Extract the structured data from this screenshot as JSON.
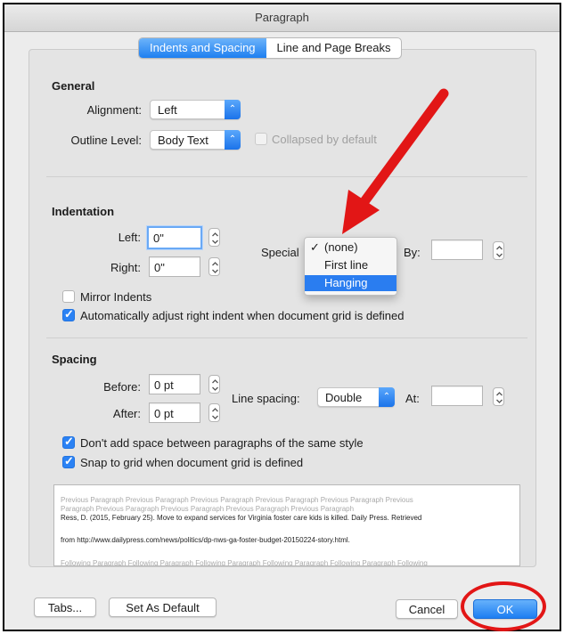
{
  "window": {
    "title": "Paragraph"
  },
  "tabs": [
    {
      "label": "Indents and Spacing",
      "active": true
    },
    {
      "label": "Line and Page Breaks",
      "active": false
    }
  ],
  "general": {
    "heading": "General",
    "alignment_label": "Alignment:",
    "alignment_value": "Left",
    "outline_label": "Outline Level:",
    "outline_value": "Body Text",
    "collapsed_label": "Collapsed by default"
  },
  "indentation": {
    "heading": "Indentation",
    "left_label": "Left:",
    "left_value": "0\"",
    "right_label": "Right:",
    "right_value": "0\"",
    "special_label": "Special",
    "by_label": "By:",
    "by_value": "",
    "mirror_label": "Mirror Indents",
    "auto_adjust_label": "Automatically adjust right indent when document grid is defined"
  },
  "special_menu": {
    "items": [
      "(none)",
      "First line",
      "Hanging"
    ],
    "checked_mark": "✓",
    "checked_item": "(none)",
    "highlighted_item": "Hanging"
  },
  "spacing": {
    "heading": "Spacing",
    "before_label": "Before:",
    "before_value": "0 pt",
    "after_label": "After:",
    "after_value": "0 pt",
    "line_spacing_label": "Line spacing:",
    "line_spacing_value": "Double",
    "at_label": "At:",
    "at_value": "",
    "dont_add_label": "Don't add space between paragraphs of the same style",
    "snap_label": "Snap to grid when document grid is defined"
  },
  "preview": {
    "line1": "Previous Paragraph Previous Paragraph Previous Paragraph Previous Paragraph Previous Paragraph Previous",
    "line2": "Paragraph Previous Paragraph Previous Paragraph Previous Paragraph Previous Paragraph",
    "line3": "Ress, D. (2015, February 25). Move to expand services for Virginia foster care kids is killed. Daily Press. Retrieved",
    "line4": "from http://www.dailypress.com/news/politics/dp-nws-ga-foster-budget-20150224-story.html.",
    "line5": "Following Paragraph Following Paragraph Following Paragraph Following Paragraph Following Paragraph Following"
  },
  "buttons": {
    "tabs": "Tabs...",
    "set_default": "Set As Default",
    "cancel": "Cancel",
    "ok": "OK"
  },
  "annotations": {
    "arrow_color": "#e21616",
    "circle_color": "#e21616"
  },
  "colors": {
    "accent": "#2a7df0",
    "panel": "#e4e4e4",
    "window": "#ececec"
  }
}
